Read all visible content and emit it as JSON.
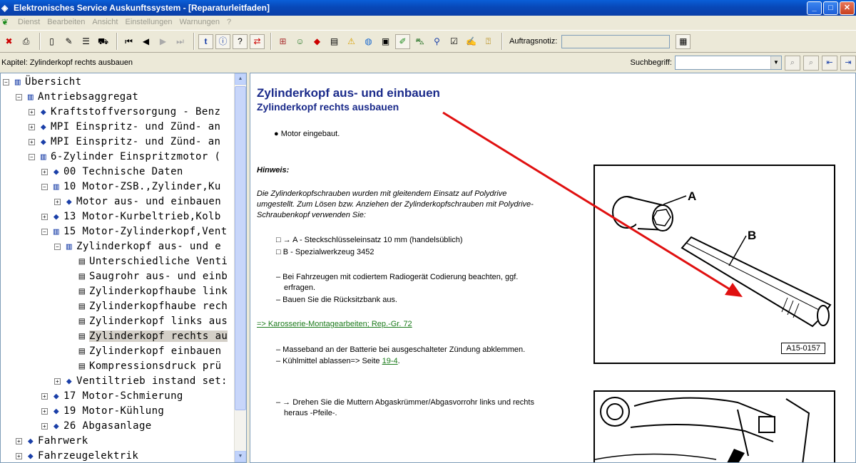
{
  "window": {
    "title": "Elektronisches Service Auskunftssystem - [Reparaturleitfaden]"
  },
  "menu": {
    "items": [
      "Dienst",
      "Bearbeiten",
      "Ansicht",
      "Einstellungen",
      "Warnungen",
      "?"
    ]
  },
  "toolbar": {
    "auftrag_label": "Auftragsnotiz:",
    "auftrag_value": ""
  },
  "chapterbar": {
    "chapter": "Kapitel: Zylinderkopf rechts ausbauen",
    "such_label": "Suchbegriff:",
    "such_value": ""
  },
  "tree": {
    "nodes": [
      {
        "label": "Übersicht",
        "expander": "−",
        "icon": "openbook"
      },
      {
        "label": "Antriebsaggregat",
        "expander": "−",
        "icon": "openbook"
      },
      {
        "label": "Kraftstoffversorgung - Benz",
        "expander": "+",
        "icon": "book"
      },
      {
        "label": "MPI Einspritz- und Zünd- an",
        "expander": "+",
        "icon": "book"
      },
      {
        "label": "MPI Einspritz- und Zünd- an",
        "expander": "+",
        "icon": "book"
      },
      {
        "label": "6-Zylinder Einspritzmotor (",
        "expander": "−",
        "icon": "openbook"
      },
      {
        "label": "00 Technische Daten",
        "expander": "+",
        "icon": "book"
      },
      {
        "label": "10 Motor-ZSB.,Zylinder,Ku",
        "expander": "−",
        "icon": "openbook"
      },
      {
        "label": "Motor aus- und einbauen",
        "expander": "+",
        "icon": "book"
      },
      {
        "label": "13 Motor-Kurbeltrieb,Kolb",
        "expander": "+",
        "icon": "book"
      },
      {
        "label": "15 Motor-Zylinderkopf,Vent",
        "expander": "−",
        "icon": "openbook"
      },
      {
        "label": "Zylinderkopf aus- und e",
        "expander": "−",
        "icon": "openbook"
      },
      {
        "label": "Unterschiedliche Venti",
        "expander": "",
        "icon": "page"
      },
      {
        "label": "Saugrohr aus- und einb",
        "expander": "",
        "icon": "page"
      },
      {
        "label": "Zylinderkopfhaube link",
        "expander": "",
        "icon": "page"
      },
      {
        "label": "Zylinderkopfhaube rech",
        "expander": "",
        "icon": "page"
      },
      {
        "label": "Zylinderkopf links aus",
        "expander": "",
        "icon": "page"
      },
      {
        "label": "Zylinderkopf rechts au",
        "expander": "",
        "icon": "page",
        "selected": true
      },
      {
        "label": "Zylinderkopf einbauen",
        "expander": "",
        "icon": "page"
      },
      {
        "label": "Kompressionsdruck prü",
        "expander": "",
        "icon": "page"
      },
      {
        "label": "Ventiltrieb instand set:",
        "expander": "+",
        "icon": "book"
      },
      {
        "label": "17 Motor-Schmierung",
        "expander": "+",
        "icon": "book"
      },
      {
        "label": "19 Motor-Kühlung",
        "expander": "+",
        "icon": "book"
      },
      {
        "label": "26 Abgasanlage",
        "expander": "+",
        "icon": "book"
      },
      {
        "label": "Fahrwerk",
        "expander": "+",
        "icon": "book"
      },
      {
        "label": "Fahrzeugelektrik",
        "expander": "+",
        "icon": "book"
      }
    ]
  },
  "content": {
    "title": "Zylinderkopf aus- und einbauen",
    "subtitle": "Zylinderkopf rechts ausbauen",
    "bullet_motor": "Motor eingebaut.",
    "hinweis": "Hinweis:",
    "hinweis_text1": "Die Zylinderkopfschrauben wurden mit gleitendem Einsatz auf Polydrive",
    "hinweis_text2": "umgestellt. Zum Lösen bzw. Anziehen der Zylinderkopfschrauben mit Polydrive-",
    "hinweis_text3": "Schraubenkopf verwenden Sie:",
    "tool_a": "→ A - Steckschlüsseleinsatz 10 mm (handelsüblich)",
    "tool_b": "B - Spezialwerkzeug 3452",
    "step_radio1": "– Bei Fahrzeugen mit codiertem Radiogerät Codierung beachten, ggf.",
    "step_radio2": "erfragen.",
    "step_bank": "– Bauen Sie die Rücksitzbank aus.",
    "link_karosserie": "=> Karosserie-Montagearbeiten; Rep.-Gr. 72",
    "step_masse": "– Masseband an der Batterie bei ausgeschalteter Zündung abklemmen.",
    "step_kuehl_pre": "– Kühlmittel ablassen=> Seite ",
    "step_kuehl_link": "19-4",
    "step_kuehl_post": ".",
    "step_mutter1": "– → Drehen Sie die Muttern Abgaskrümmer/Abgasvorrohr links und rechts",
    "step_mutter2": "heraus -Pfeile-.",
    "figure1": {
      "label_a": "A",
      "label_b": "B",
      "ref": "A15-0157"
    }
  }
}
